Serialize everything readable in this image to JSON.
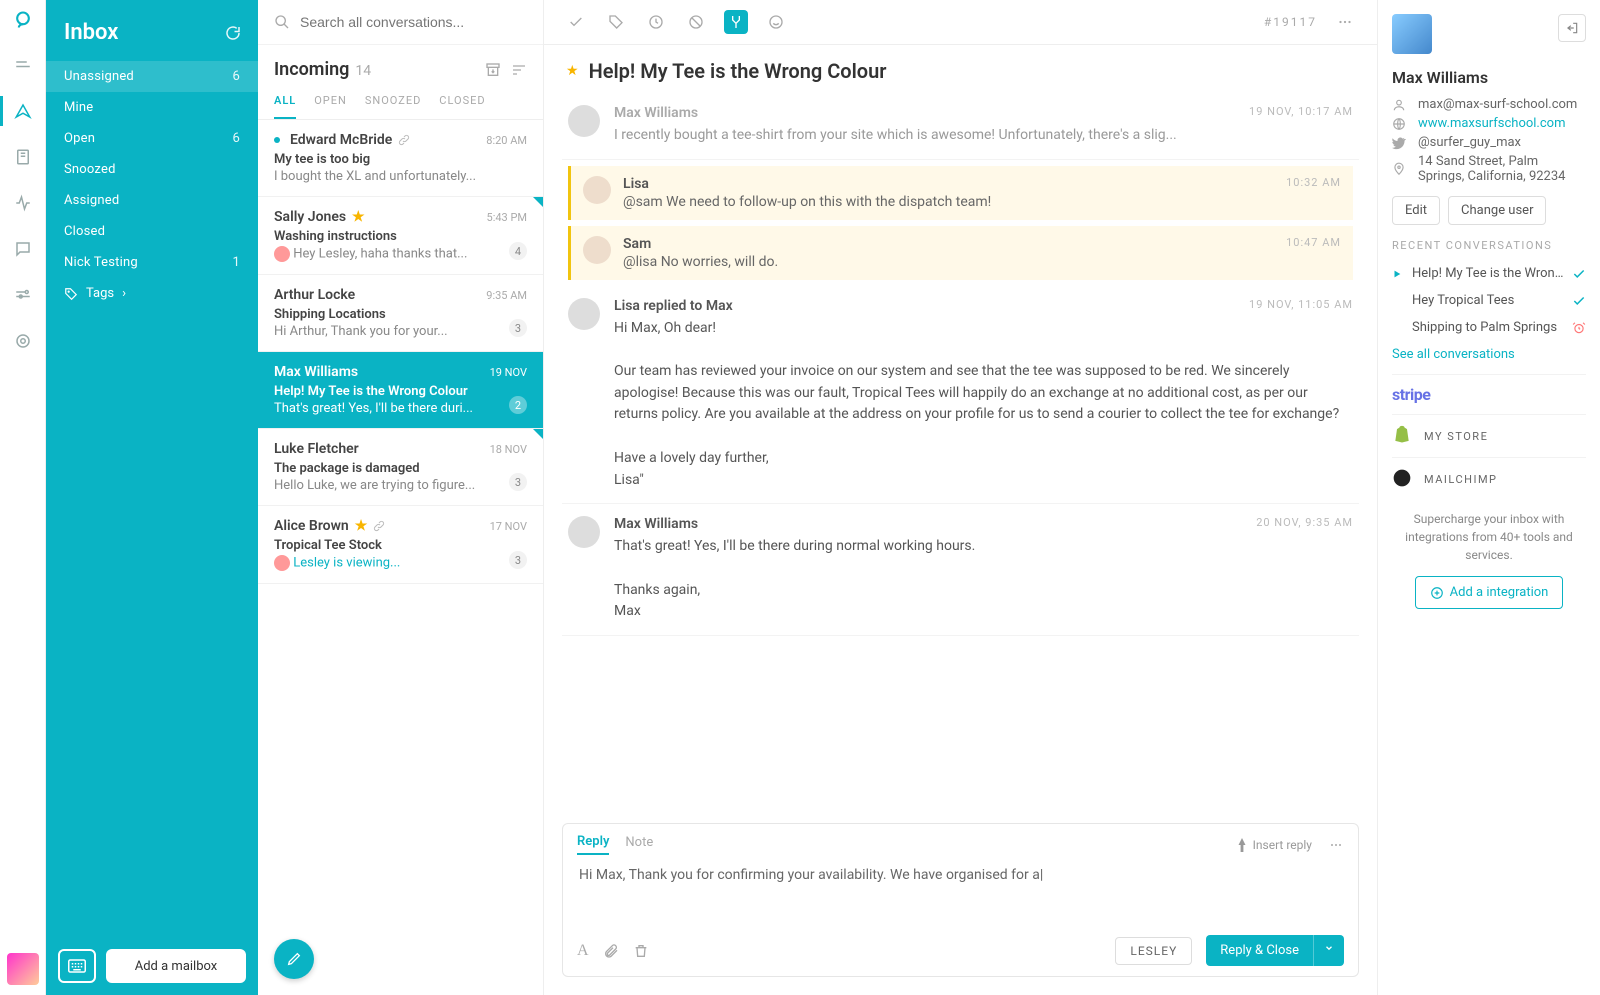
{
  "search": {
    "placeholder": "Search all conversations..."
  },
  "sidebar": {
    "title": "Inbox",
    "items": [
      {
        "label": "Unassigned",
        "count": "6"
      },
      {
        "label": "Mine",
        "count": ""
      },
      {
        "label": "Open",
        "count": "6"
      },
      {
        "label": "Snoozed",
        "count": ""
      },
      {
        "label": "Assigned",
        "count": ""
      },
      {
        "label": "Closed",
        "count": ""
      },
      {
        "label": "Nick Testing",
        "count": "1"
      }
    ],
    "tags_label": "Tags",
    "add_mailbox": "Add a mailbox"
  },
  "listheader": {
    "title": "Incoming",
    "count": "14"
  },
  "listtabs": [
    "ALL",
    "OPEN",
    "SNOOZED",
    "CLOSED"
  ],
  "convos": [
    {
      "name": "Edward McBride",
      "date": "8:20 AM",
      "subject": "My tee is too big",
      "preview": "I bought the XL and unfortunately...",
      "unread": true,
      "attachment": true
    },
    {
      "name": "Sally Jones",
      "date": "5:43 PM",
      "subject": "Washing instructions",
      "preview": "Hey Lesley, haha thanks that...",
      "starred": true,
      "badge": "4",
      "ava": true,
      "corner": true
    },
    {
      "name": "Arthur Locke",
      "date": "9:35 AM",
      "subject": "Shipping Locations",
      "preview": "Hi Arthur, Thank you for your...",
      "badge": "3"
    },
    {
      "name": "Max Williams",
      "date": "19 NOV",
      "subject": "Help! My Tee is the Wrong Colour",
      "preview": "That's great! Yes, I'll be there duri...",
      "badge": "2",
      "selected": true,
      "corner": true
    },
    {
      "name": "Luke Fletcher",
      "date": "18 NOV",
      "subject": "The package is damaged",
      "preview": "Hello Luke, we are trying to figure...",
      "badge": "3",
      "corner": true
    },
    {
      "name": "Alice Brown",
      "date": "17 NOV",
      "subject": "Tropical Tee Stock",
      "preview": "Lesley is viewing...",
      "starred": true,
      "attachment": true,
      "badge": "3",
      "viewing": true,
      "ava": true
    }
  ],
  "ticket": {
    "id": "#19117",
    "title": "Help! My Tee is the Wrong Colour"
  },
  "thread": [
    {
      "kind": "msg",
      "from": "Max Williams",
      "time": "19 NOV, 10:17 AM",
      "collapsed": true,
      "body": "I recently bought a tee-shirt from your site which is awesome! Unfortunately, there's a slig..."
    },
    {
      "kind": "note",
      "from": "Lisa",
      "time": "10:32 AM",
      "body": "@sam We need to follow-up on this with the dispatch team!"
    },
    {
      "kind": "note",
      "from": "Sam",
      "time": "10:47 AM",
      "body": "@lisa No worries, will do."
    },
    {
      "kind": "msg",
      "from": "Lisa replied to Max",
      "time": "19 NOV, 11:05 AM",
      "body": "Hi Max, Oh dear!\n\nOur team has reviewed your invoice on our system and see that the tee was supposed to be red. We sincerely apologise! Because this was our fault, Tropical Tees will happily do an exchange at no additional cost, as per our returns policy. Are you available at the address on your profile for us to send a courier to collect the tee for exchange?\n\nHave a lovely day further,\nLisa\""
    },
    {
      "kind": "msg",
      "from": "Max Williams",
      "time": "20 NOV, 9:35 AM",
      "body": "That's great! Yes, I'll be there during normal working hours.\n\nThanks again,\nMax"
    }
  ],
  "composer": {
    "tabs": [
      "Reply",
      "Note"
    ],
    "insert": "Insert reply",
    "text": "Hi Max, Thank you for confirming your availability. We have organised for a|",
    "user": "LESLEY",
    "send": "Reply & Close"
  },
  "profile": {
    "name": "Max Williams",
    "email": "max@max-surf-school.com",
    "website": "www.maxsurfschool.com",
    "twitter": "@surfer_guy_max",
    "address": "14 Sand Street, Palm Springs, California, 92234",
    "edit": "Edit",
    "change": "Change user",
    "recent_label": "RECENT CONVERSATIONS",
    "recent": [
      {
        "title": "Help! My Tee is the Wron...",
        "status": "check",
        "active": true
      },
      {
        "title": "Hey Tropical Tees",
        "status": "check"
      },
      {
        "title": "Shipping to Palm Springs",
        "status": "alarm"
      }
    ],
    "seeall": "See all conversations",
    "integrations": [
      "MY STORE",
      "MAILCHIMP"
    ],
    "promo": "Supercharge your inbox with integrations from 40+ tools and services.",
    "addint": "Add a integration"
  }
}
